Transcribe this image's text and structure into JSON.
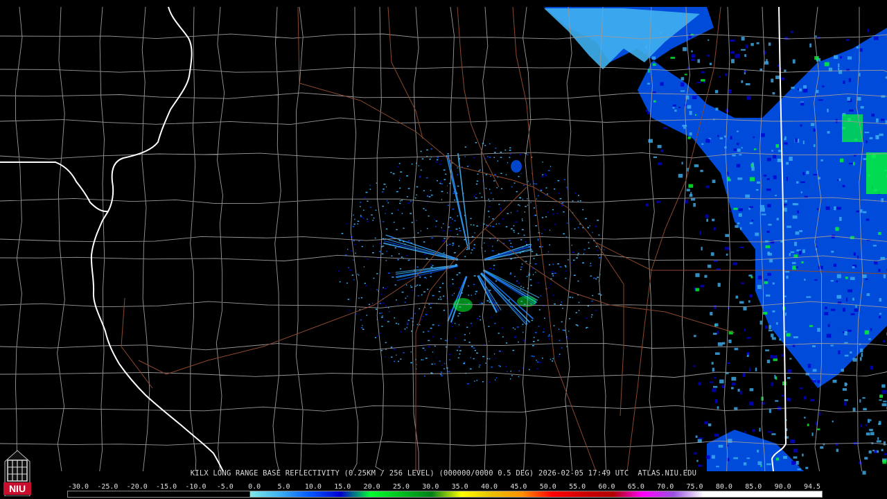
{
  "caption": {
    "text": "KILX LONG RANGE BASE REFLECTIVITY (0.25KM / 256 LEVEL) (000000/0000 0.5 DEG) 2026-02-05 17:49 UTC  ATLAS.NIU.EDU"
  },
  "logo": {
    "text": "NIU",
    "color": "#c8102e"
  },
  "color_scale": {
    "labels": [
      "-30.0",
      "-25.0",
      "-20.0",
      "-15.0",
      "-10.0",
      "-5.0",
      "0.0",
      "5.0",
      "10.0",
      "15.0",
      "20.0",
      "25.0",
      "30.0",
      "35.0",
      "40.0",
      "45.0",
      "50.0",
      "55.0",
      "60.0",
      "65.0",
      "70.0",
      "75.0",
      "80.0",
      "85.0",
      "90.0",
      "94.5"
    ],
    "stops": [
      {
        "value": -30,
        "color": "#000000"
      },
      {
        "value": 0,
        "color": "#000000"
      },
      {
        "value": 0.1,
        "color": "#7fe8e8"
      },
      {
        "value": 5,
        "color": "#3fb0f0"
      },
      {
        "value": 10,
        "color": "#0058ff"
      },
      {
        "value": 15,
        "color": "#0000d0"
      },
      {
        "value": 20,
        "color": "#00ff30"
      },
      {
        "value": 25,
        "color": "#00c020"
      },
      {
        "value": 30,
        "color": "#008018"
      },
      {
        "value": 35,
        "color": "#ffff00"
      },
      {
        "value": 40,
        "color": "#e8c000"
      },
      {
        "value": 45,
        "color": "#ff9000"
      },
      {
        "value": 50,
        "color": "#ff0000"
      },
      {
        "value": 55,
        "color": "#d00000"
      },
      {
        "value": 60,
        "color": "#b00000"
      },
      {
        "value": 65,
        "color": "#ff00ff"
      },
      {
        "value": 70,
        "color": "#9a50e0"
      },
      {
        "value": 75,
        "color": "#ffffff"
      },
      {
        "value": 94.5,
        "color": "#ffffff"
      }
    ]
  },
  "map_colors": {
    "background": "#000000",
    "county_lines": "#9a9a9a",
    "state_lines": "#ffffff",
    "highways": "#8b4a2f",
    "echo_light": "#3fb0f0",
    "echo_mid": "#0058ff",
    "echo_dark": "#0000d0",
    "echo_green": "#00ff30"
  },
  "radar_site": "KILX"
}
